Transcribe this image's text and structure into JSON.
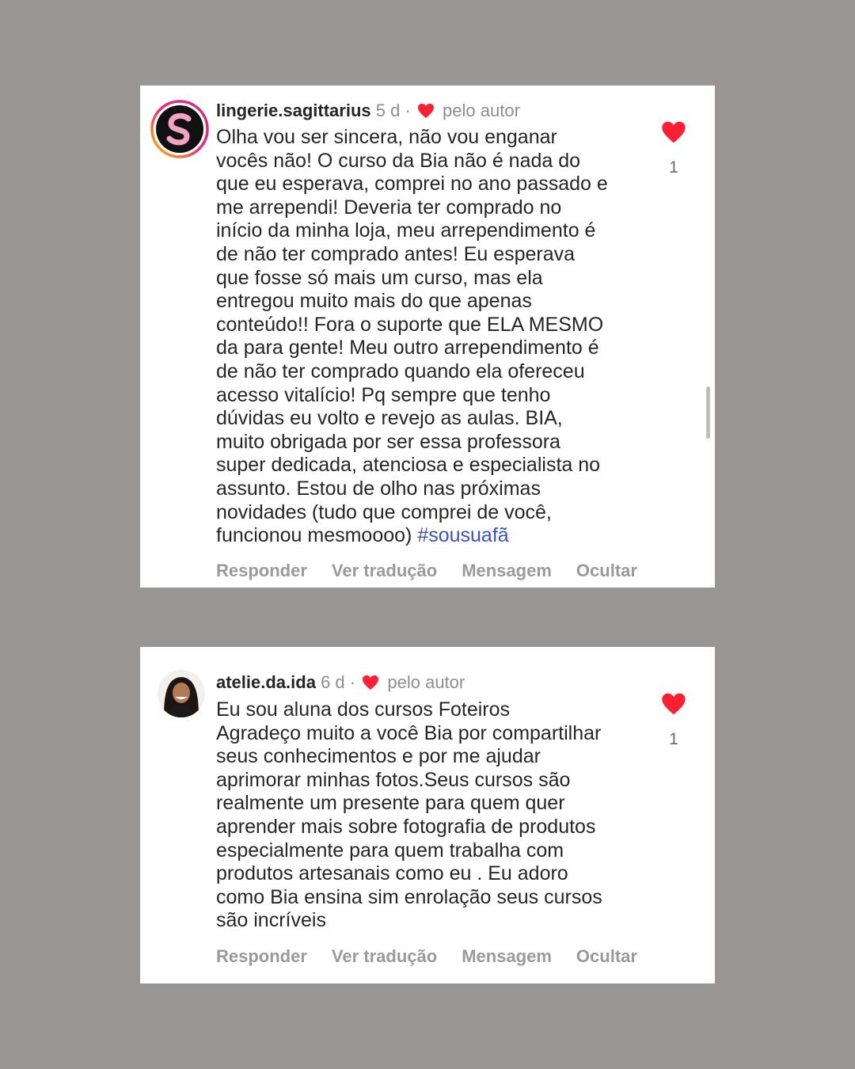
{
  "comments": [
    {
      "username": "lingerie.sagittarius",
      "time": "5 d",
      "separator": "·",
      "liked_by": "pelo autor",
      "text": "Olha vou ser sincera, não vou enganar\nvocês não! O curso da Bia não é nada do\nque eu esperava, comprei no ano passado e\nme arrependi! Deveria ter comprado no\ninício da minha loja, meu arrependimento é\nde não ter comprado antes! Eu esperava\nque fosse só mais um curso, mas ela\nentregou muito mais do que apenas\nconteúdo!! Fora o suporte que ELA MESMO\nda para gente! Meu outro arrependimento é\nde não ter comprado quando ela ofereceu\nacesso vitalício! Pq sempre que tenho\ndúvidas eu volto e revejo as aulas. BIA,\nmuito obrigada por ser essa professora\nsuper dedicada, atenciosa e especialista no\nassunto. Estou de olho nas próximas\nnovidades (tudo que comprei de você,\nfuncionou mesmoooo) ",
      "hashtag": "#sousuafã",
      "likes": "1",
      "actions": {
        "reply": "Responder",
        "translate": "Ver tradução",
        "message": "Mensagem",
        "hide": "Ocultar"
      }
    },
    {
      "username": "atelie.da.ida",
      "time": "6 d",
      "separator": "·",
      "liked_by": "pelo autor",
      "text": "Eu sou aluna  dos cursos  Foteiros\nAgradeço muito a você Bia por compartilhar\nseus conhecimentos e por me ajudar\naprimorar  minhas fotos.Seus cursos são\nrealmente um presente para quem quer\naprender mais sobre fotografia de produtos\nespecialmente para quem trabalha com\nprodutos artesanais como eu . Eu adoro\ncomo Bia ensina sim enrolação seus cursos\nsão  incríveis",
      "likes": "1",
      "actions": {
        "reply": "Responder",
        "translate": "Ver tradução",
        "message": "Mensagem",
        "hide": "Ocultar"
      }
    }
  ],
  "colors": {
    "background": "#9a9595",
    "heart": "#ff1f35",
    "hashtag": "#3b50c4",
    "muted": "#8e8e8e"
  },
  "icons": {
    "like": "heart-filled-icon",
    "author_like": "heart-small-icon",
    "avatar_1": "s-logo-icon",
    "avatar_2": "profile-photo"
  }
}
